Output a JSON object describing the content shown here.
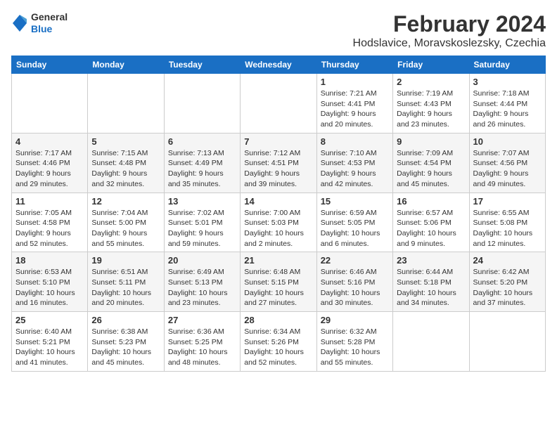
{
  "header": {
    "logo_general": "General",
    "logo_blue": "Blue",
    "month_title": "February 2024",
    "location": "Hodslavice, Moravskoslezsky, Czechia"
  },
  "days_of_week": [
    "Sunday",
    "Monday",
    "Tuesday",
    "Wednesday",
    "Thursday",
    "Friday",
    "Saturday"
  ],
  "weeks": [
    [
      {
        "day": "",
        "info": ""
      },
      {
        "day": "",
        "info": ""
      },
      {
        "day": "",
        "info": ""
      },
      {
        "day": "",
        "info": ""
      },
      {
        "day": "1",
        "info": "Sunrise: 7:21 AM\nSunset: 4:41 PM\nDaylight: 9 hours\nand 20 minutes."
      },
      {
        "day": "2",
        "info": "Sunrise: 7:19 AM\nSunset: 4:43 PM\nDaylight: 9 hours\nand 23 minutes."
      },
      {
        "day": "3",
        "info": "Sunrise: 7:18 AM\nSunset: 4:44 PM\nDaylight: 9 hours\nand 26 minutes."
      }
    ],
    [
      {
        "day": "4",
        "info": "Sunrise: 7:17 AM\nSunset: 4:46 PM\nDaylight: 9 hours\nand 29 minutes."
      },
      {
        "day": "5",
        "info": "Sunrise: 7:15 AM\nSunset: 4:48 PM\nDaylight: 9 hours\nand 32 minutes."
      },
      {
        "day": "6",
        "info": "Sunrise: 7:13 AM\nSunset: 4:49 PM\nDaylight: 9 hours\nand 35 minutes."
      },
      {
        "day": "7",
        "info": "Sunrise: 7:12 AM\nSunset: 4:51 PM\nDaylight: 9 hours\nand 39 minutes."
      },
      {
        "day": "8",
        "info": "Sunrise: 7:10 AM\nSunset: 4:53 PM\nDaylight: 9 hours\nand 42 minutes."
      },
      {
        "day": "9",
        "info": "Sunrise: 7:09 AM\nSunset: 4:54 PM\nDaylight: 9 hours\nand 45 minutes."
      },
      {
        "day": "10",
        "info": "Sunrise: 7:07 AM\nSunset: 4:56 PM\nDaylight: 9 hours\nand 49 minutes."
      }
    ],
    [
      {
        "day": "11",
        "info": "Sunrise: 7:05 AM\nSunset: 4:58 PM\nDaylight: 9 hours\nand 52 minutes."
      },
      {
        "day": "12",
        "info": "Sunrise: 7:04 AM\nSunset: 5:00 PM\nDaylight: 9 hours\nand 55 minutes."
      },
      {
        "day": "13",
        "info": "Sunrise: 7:02 AM\nSunset: 5:01 PM\nDaylight: 9 hours\nand 59 minutes."
      },
      {
        "day": "14",
        "info": "Sunrise: 7:00 AM\nSunset: 5:03 PM\nDaylight: 10 hours\nand 2 minutes."
      },
      {
        "day": "15",
        "info": "Sunrise: 6:59 AM\nSunset: 5:05 PM\nDaylight: 10 hours\nand 6 minutes."
      },
      {
        "day": "16",
        "info": "Sunrise: 6:57 AM\nSunset: 5:06 PM\nDaylight: 10 hours\nand 9 minutes."
      },
      {
        "day": "17",
        "info": "Sunrise: 6:55 AM\nSunset: 5:08 PM\nDaylight: 10 hours\nand 12 minutes."
      }
    ],
    [
      {
        "day": "18",
        "info": "Sunrise: 6:53 AM\nSunset: 5:10 PM\nDaylight: 10 hours\nand 16 minutes."
      },
      {
        "day": "19",
        "info": "Sunrise: 6:51 AM\nSunset: 5:11 PM\nDaylight: 10 hours\nand 20 minutes."
      },
      {
        "day": "20",
        "info": "Sunrise: 6:49 AM\nSunset: 5:13 PM\nDaylight: 10 hours\nand 23 minutes."
      },
      {
        "day": "21",
        "info": "Sunrise: 6:48 AM\nSunset: 5:15 PM\nDaylight: 10 hours\nand 27 minutes."
      },
      {
        "day": "22",
        "info": "Sunrise: 6:46 AM\nSunset: 5:16 PM\nDaylight: 10 hours\nand 30 minutes."
      },
      {
        "day": "23",
        "info": "Sunrise: 6:44 AM\nSunset: 5:18 PM\nDaylight: 10 hours\nand 34 minutes."
      },
      {
        "day": "24",
        "info": "Sunrise: 6:42 AM\nSunset: 5:20 PM\nDaylight: 10 hours\nand 37 minutes."
      }
    ],
    [
      {
        "day": "25",
        "info": "Sunrise: 6:40 AM\nSunset: 5:21 PM\nDaylight: 10 hours\nand 41 minutes."
      },
      {
        "day": "26",
        "info": "Sunrise: 6:38 AM\nSunset: 5:23 PM\nDaylight: 10 hours\nand 45 minutes."
      },
      {
        "day": "27",
        "info": "Sunrise: 6:36 AM\nSunset: 5:25 PM\nDaylight: 10 hours\nand 48 minutes."
      },
      {
        "day": "28",
        "info": "Sunrise: 6:34 AM\nSunset: 5:26 PM\nDaylight: 10 hours\nand 52 minutes."
      },
      {
        "day": "29",
        "info": "Sunrise: 6:32 AM\nSunset: 5:28 PM\nDaylight: 10 hours\nand 55 minutes."
      },
      {
        "day": "",
        "info": ""
      },
      {
        "day": "",
        "info": ""
      }
    ]
  ]
}
